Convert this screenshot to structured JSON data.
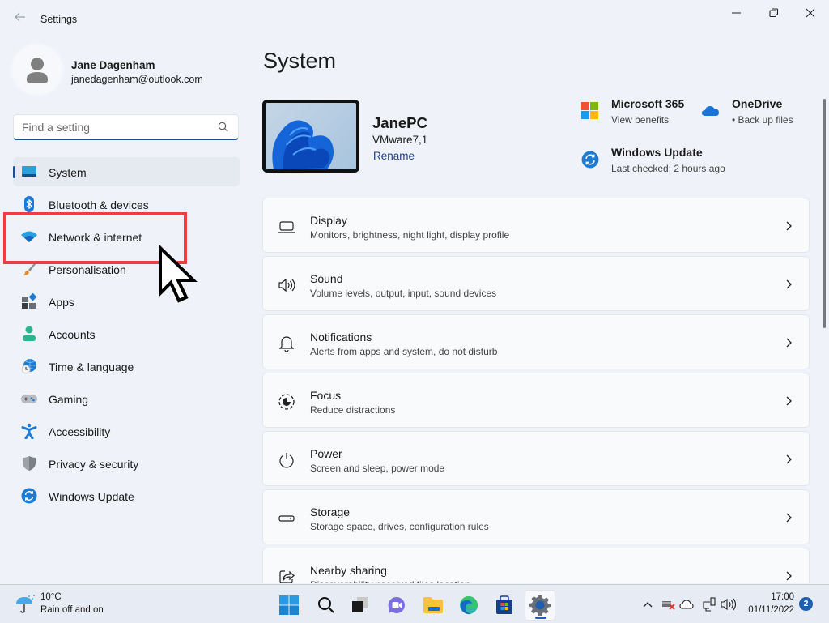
{
  "window": {
    "title": "Settings",
    "controls": [
      "minimize",
      "maximize",
      "close"
    ]
  },
  "profile": {
    "name": "Jane Dagenham",
    "email": "janedagenham@outlook.com"
  },
  "search": {
    "placeholder": "Find a setting",
    "value": ""
  },
  "sidebar": {
    "items": [
      {
        "label": "System",
        "icon": "system-icon",
        "active": true
      },
      {
        "label": "Bluetooth & devices",
        "icon": "bluetooth-icon",
        "active": false
      },
      {
        "label": "Network & internet",
        "icon": "wifi-icon",
        "active": false
      },
      {
        "label": "Personalisation",
        "icon": "paintbrush-icon",
        "active": false
      },
      {
        "label": "Apps",
        "icon": "apps-icon",
        "active": false
      },
      {
        "label": "Accounts",
        "icon": "accounts-icon",
        "active": false
      },
      {
        "label": "Time & language",
        "icon": "time-language-icon",
        "active": false
      },
      {
        "label": "Gaming",
        "icon": "gamepad-icon",
        "active": false
      },
      {
        "label": "Accessibility",
        "icon": "accessibility-icon",
        "active": false
      },
      {
        "label": "Privacy & security",
        "icon": "shield-icon",
        "active": false
      },
      {
        "label": "Windows Update",
        "icon": "windows-update-icon",
        "active": false
      }
    ],
    "highlighted_item": "Network & internet",
    "highlight_color": "#ee3d44"
  },
  "main": {
    "title": "System",
    "device": {
      "name": "JanePC",
      "model": "VMware7,1",
      "rename_label": "Rename"
    },
    "quick_links": [
      {
        "title": "Microsoft 365",
        "subtitle": "View benefits",
        "icon": "microsoft-365-icon"
      },
      {
        "title": "OneDrive",
        "subtitle": "• Back up files",
        "icon": "onedrive-icon"
      },
      {
        "title": "Windows Update",
        "subtitle": "Last checked: 2 hours ago",
        "icon": "windows-update-icon"
      }
    ],
    "cards": [
      {
        "title": "Display",
        "subtitle": "Monitors, brightness, night light, display profile",
        "icon": "display-icon"
      },
      {
        "title": "Sound",
        "subtitle": "Volume levels, output, input, sound devices",
        "icon": "speaker-icon"
      },
      {
        "title": "Notifications",
        "subtitle": "Alerts from apps and system, do not disturb",
        "icon": "bell-icon"
      },
      {
        "title": "Focus",
        "subtitle": "Reduce distractions",
        "icon": "focus-icon"
      },
      {
        "title": "Power",
        "subtitle": "Screen and sleep, power mode",
        "icon": "power-icon"
      },
      {
        "title": "Storage",
        "subtitle": "Storage space, drives, configuration rules",
        "icon": "storage-icon"
      },
      {
        "title": "Nearby sharing",
        "subtitle": "Discoverability, received files location",
        "icon": "share-icon"
      }
    ]
  },
  "taskbar": {
    "weather": {
      "temp": "10°C",
      "desc": "Rain off and on"
    },
    "apps": [
      {
        "name": "start",
        "icon": "windows-logo-icon"
      },
      {
        "name": "search",
        "icon": "search-icon"
      },
      {
        "name": "task-view",
        "icon": "task-view-icon"
      },
      {
        "name": "teams-chat",
        "icon": "chat-icon"
      },
      {
        "name": "file-explorer",
        "icon": "folder-icon"
      },
      {
        "name": "edge",
        "icon": "edge-icon"
      },
      {
        "name": "store",
        "icon": "store-icon"
      },
      {
        "name": "settings",
        "icon": "gear-icon",
        "active": true
      }
    ],
    "tray": {
      "time": "17:00",
      "date": "01/11/2022",
      "notifications": "2"
    }
  },
  "colors": {
    "accent": "#1f4e8c",
    "background": "#eff3f9",
    "card": "#f9fafc",
    "highlight": "#ee3d44"
  }
}
